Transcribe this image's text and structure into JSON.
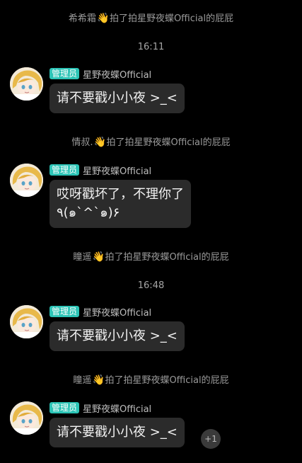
{
  "chat": {
    "pokes": [
      {
        "from": "希希霜",
        "action": "拍了拍星野夜蝶Official的屁屁"
      },
      {
        "from": "情叔.",
        "action": "拍了拍星野夜蝶Official的屁屁"
      },
      {
        "from": "瞳遥",
        "action": "拍了拍星野夜蝶Official的屁屁"
      },
      {
        "from": "瞳遥",
        "action": "拍了拍星野夜蝶Official的屁屁"
      }
    ],
    "timestamps": [
      "16:11",
      "16:48"
    ],
    "messages": [
      {
        "role": "管理员",
        "sender": "星野夜蝶Official",
        "text": "请不要戳小小夜 >_<"
      },
      {
        "role": "管理员",
        "sender": "星野夜蝶Official",
        "text": "哎呀戳坏了，不理你了\n٩(๑`^`๑)۶"
      },
      {
        "role": "管理员",
        "sender": "星野夜蝶Official",
        "text": "请不要戳小小夜 >_<"
      },
      {
        "role": "管理员",
        "sender": "星野夜蝶Official",
        "text": "请不要戳小小夜 >_<"
      }
    ],
    "plus_one_label": "+1"
  },
  "icons": {
    "poke": "waving-hand-icon",
    "avatar": "anime-avatar"
  },
  "colors": {
    "background": "#000000",
    "bubble": "#2b2b2b",
    "role_badge": "#2cc4b6",
    "system_text": "#9a9a9a"
  }
}
